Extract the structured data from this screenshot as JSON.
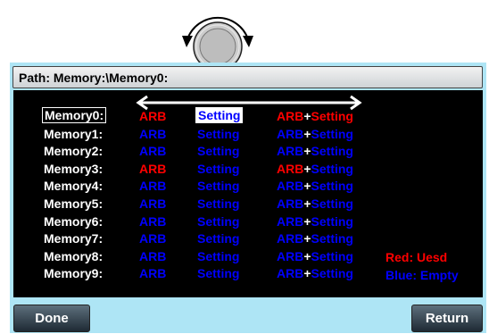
{
  "path": {
    "label": "Path: Memory:\\Memory0:"
  },
  "memory_rows": [
    {
      "name": "Memory0:",
      "arb": "ARB",
      "setting": "Setting",
      "arb_part": "ARB",
      "plus": "+",
      "setting_part": "Setting",
      "arb_color": "#ff0000",
      "setting_color": "#0000ff",
      "both_arb_color": "#ff0000",
      "both_setting_color": "#ff0000",
      "selected": true
    },
    {
      "name": "Memory1:",
      "arb": "ARB",
      "setting": "Setting",
      "arb_part": "ARB",
      "plus": "+",
      "setting_part": "Setting",
      "arb_color": "#0000ff",
      "setting_color": "#0000ff",
      "both_arb_color": "#0000ff",
      "both_setting_color": "#0000ff"
    },
    {
      "name": "Memory2:",
      "arb": "ARB",
      "setting": "Setting",
      "arb_part": "ARB",
      "plus": "+",
      "setting_part": "Setting",
      "arb_color": "#0000ff",
      "setting_color": "#0000ff",
      "both_arb_color": "#0000ff",
      "both_setting_color": "#0000ff"
    },
    {
      "name": "Memory3:",
      "arb": "ARB",
      "setting": "Setting",
      "arb_part": "ARB",
      "plus": "+",
      "setting_part": "Setting",
      "arb_color": "#ff0000",
      "setting_color": "#0000ff",
      "both_arb_color": "#ff0000",
      "both_setting_color": "#0000ff"
    },
    {
      "name": "Memory4:",
      "arb": "ARB",
      "setting": "Setting",
      "arb_part": "ARB",
      "plus": "+",
      "setting_part": "Setting",
      "arb_color": "#0000ff",
      "setting_color": "#0000ff",
      "both_arb_color": "#0000ff",
      "both_setting_color": "#0000ff"
    },
    {
      "name": "Memory5:",
      "arb": "ARB",
      "setting": "Setting",
      "arb_part": "ARB",
      "plus": "+",
      "setting_part": "Setting",
      "arb_color": "#0000ff",
      "setting_color": "#0000ff",
      "both_arb_color": "#0000ff",
      "both_setting_color": "#0000ff"
    },
    {
      "name": "Memory6:",
      "arb": "ARB",
      "setting": "Setting",
      "arb_part": "ARB",
      "plus": "+",
      "setting_part": "Setting",
      "arb_color": "#0000ff",
      "setting_color": "#0000ff",
      "both_arb_color": "#0000ff",
      "both_setting_color": "#0000ff"
    },
    {
      "name": "Memory7:",
      "arb": "ARB",
      "setting": "Setting",
      "arb_part": "ARB",
      "plus": "+",
      "setting_part": "Setting",
      "arb_color": "#0000ff",
      "setting_color": "#0000ff",
      "both_arb_color": "#0000ff",
      "both_setting_color": "#0000ff"
    },
    {
      "name": "Memory8:",
      "arb": "ARB",
      "setting": "Setting",
      "arb_part": "ARB",
      "plus": "+",
      "setting_part": "Setting",
      "arb_color": "#0000ff",
      "setting_color": "#0000ff",
      "both_arb_color": "#0000ff",
      "both_setting_color": "#0000ff"
    },
    {
      "name": "Memory9:",
      "arb": "ARB",
      "setting": "Setting",
      "arb_part": "ARB",
      "plus": "+",
      "setting_part": "Setting",
      "arb_color": "#0000ff",
      "setting_color": "#0000ff",
      "both_arb_color": "#0000ff",
      "both_setting_color": "#0000ff"
    }
  ],
  "legend": {
    "used": "Red: Uesd",
    "empty": "Blue: Empty",
    "used_color": "#ff0000",
    "empty_color": "#0000ff"
  },
  "softkeys": {
    "done": "Done",
    "return": "Return"
  },
  "icons": {
    "knob": "scroll-knob-icon",
    "arrow": "left-right-arrow-icon"
  }
}
